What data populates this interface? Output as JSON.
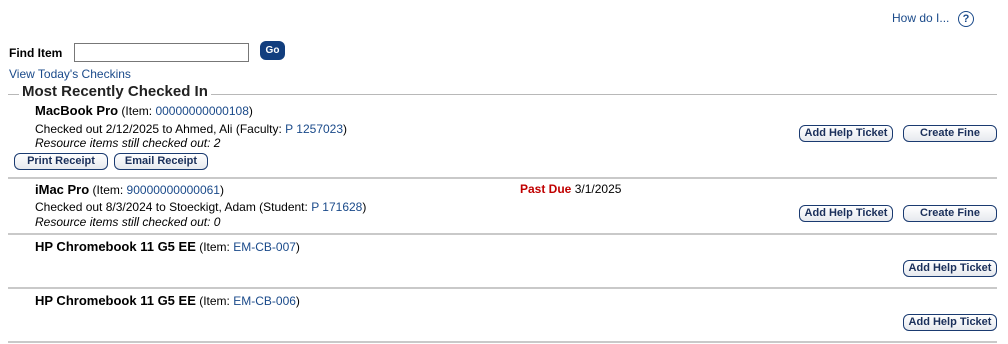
{
  "header": {
    "how_do_i": "How do I...",
    "help_glyph": "?"
  },
  "find": {
    "label": "Find Item",
    "input_value": "",
    "go_label": "Go",
    "todays_link": "View Today's Checkins"
  },
  "section": {
    "title": "Most Recently Checked In"
  },
  "items": [
    {
      "name": "MacBook Pro",
      "item_prefix": "(Item: ",
      "item_id": "00000000000108",
      "item_suffix": ")",
      "checkout_text": "Checked out 2/12/2025 to Ahmed, Ali",
      "role_prefix": "(Faculty: ",
      "role_id": "P 1257023",
      "role_suffix": ")",
      "remaining": "Resource items still checked out: 2",
      "help_ticket": "Add Help Ticket",
      "create_fine": "Create Fine",
      "print_receipt": "Print Receipt",
      "email_receipt": "Email Receipt"
    },
    {
      "name": "iMac Pro",
      "item_prefix": "(Item: ",
      "item_id": "90000000000061",
      "item_suffix": ")",
      "past_due_label": "Past Due",
      "past_due_date": "3/1/2025",
      "checkout_text": "Checked out 8/3/2024 to Stoeckigt, Adam",
      "role_prefix": "(Student: ",
      "role_id": "P 171628",
      "role_suffix": ")",
      "remaining": "Resource items still checked out: 0",
      "help_ticket": "Add Help Ticket",
      "create_fine": "Create Fine"
    },
    {
      "name": "HP Chromebook 11 G5 EE",
      "item_prefix": "(Item: ",
      "item_id": "EM-CB-007",
      "item_suffix": ")",
      "help_ticket": "Add Help Ticket"
    },
    {
      "name": "HP Chromebook 11 G5 EE",
      "item_prefix": "(Item: ",
      "item_id": "EM-CB-006",
      "item_suffix": ")",
      "help_ticket": "Add Help Ticket"
    }
  ]
}
